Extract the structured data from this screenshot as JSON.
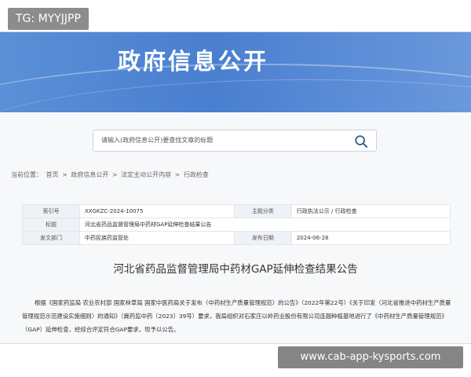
{
  "watermark": "TG: MYYJJPP",
  "banner": {
    "title": "政府信息公开"
  },
  "search": {
    "placeholder": "请输入(政府信息公开)要查找文章的标题"
  },
  "breadcrumb": {
    "prefix": "当前位置：",
    "items": [
      "首页",
      "政府信息公开",
      "法定主动公开内容",
      "行政检查"
    ],
    "separator": " > "
  },
  "meta": {
    "index_label": "索引号",
    "index_value": "XXGKZC-2024-10075",
    "category_label": "主题分类",
    "category_value": "行政执法公示 / 行政检查",
    "title_label": "标题",
    "title_value": "河北省药品监督管理局中药材GAP延伸检查结果公告",
    "dept_label": "发文部门",
    "dept_value": "中药民族药监管处",
    "date_label": "发布日期",
    "date_value": "2024-06-28"
  },
  "document": {
    "title": "河北省药品监督管理局中药材GAP延伸检查结果公告",
    "body": "根据《国家药监局 农业农村部 国家林草局 国家中医药局关于发布〈中药材生产质量管理规范〉的公告》（2022年第22号）《关于印发〈河北省推进中药材生产质量管理规范示范建设实施细则〉的通知》（冀药监中药〔2023〕39号）要求，我局组织对石家庄以岭药业股份有限公司连翘种植基地进行了《中药材生产质量管理规范》（GAP）延伸检查，经综合评定符合GAP要求，现予以公告。"
  },
  "url_badge": "www.cab-app-kysports.com",
  "colors": {
    "banner": "#4a7fd0",
    "search_icon": "#2f5f8a"
  }
}
